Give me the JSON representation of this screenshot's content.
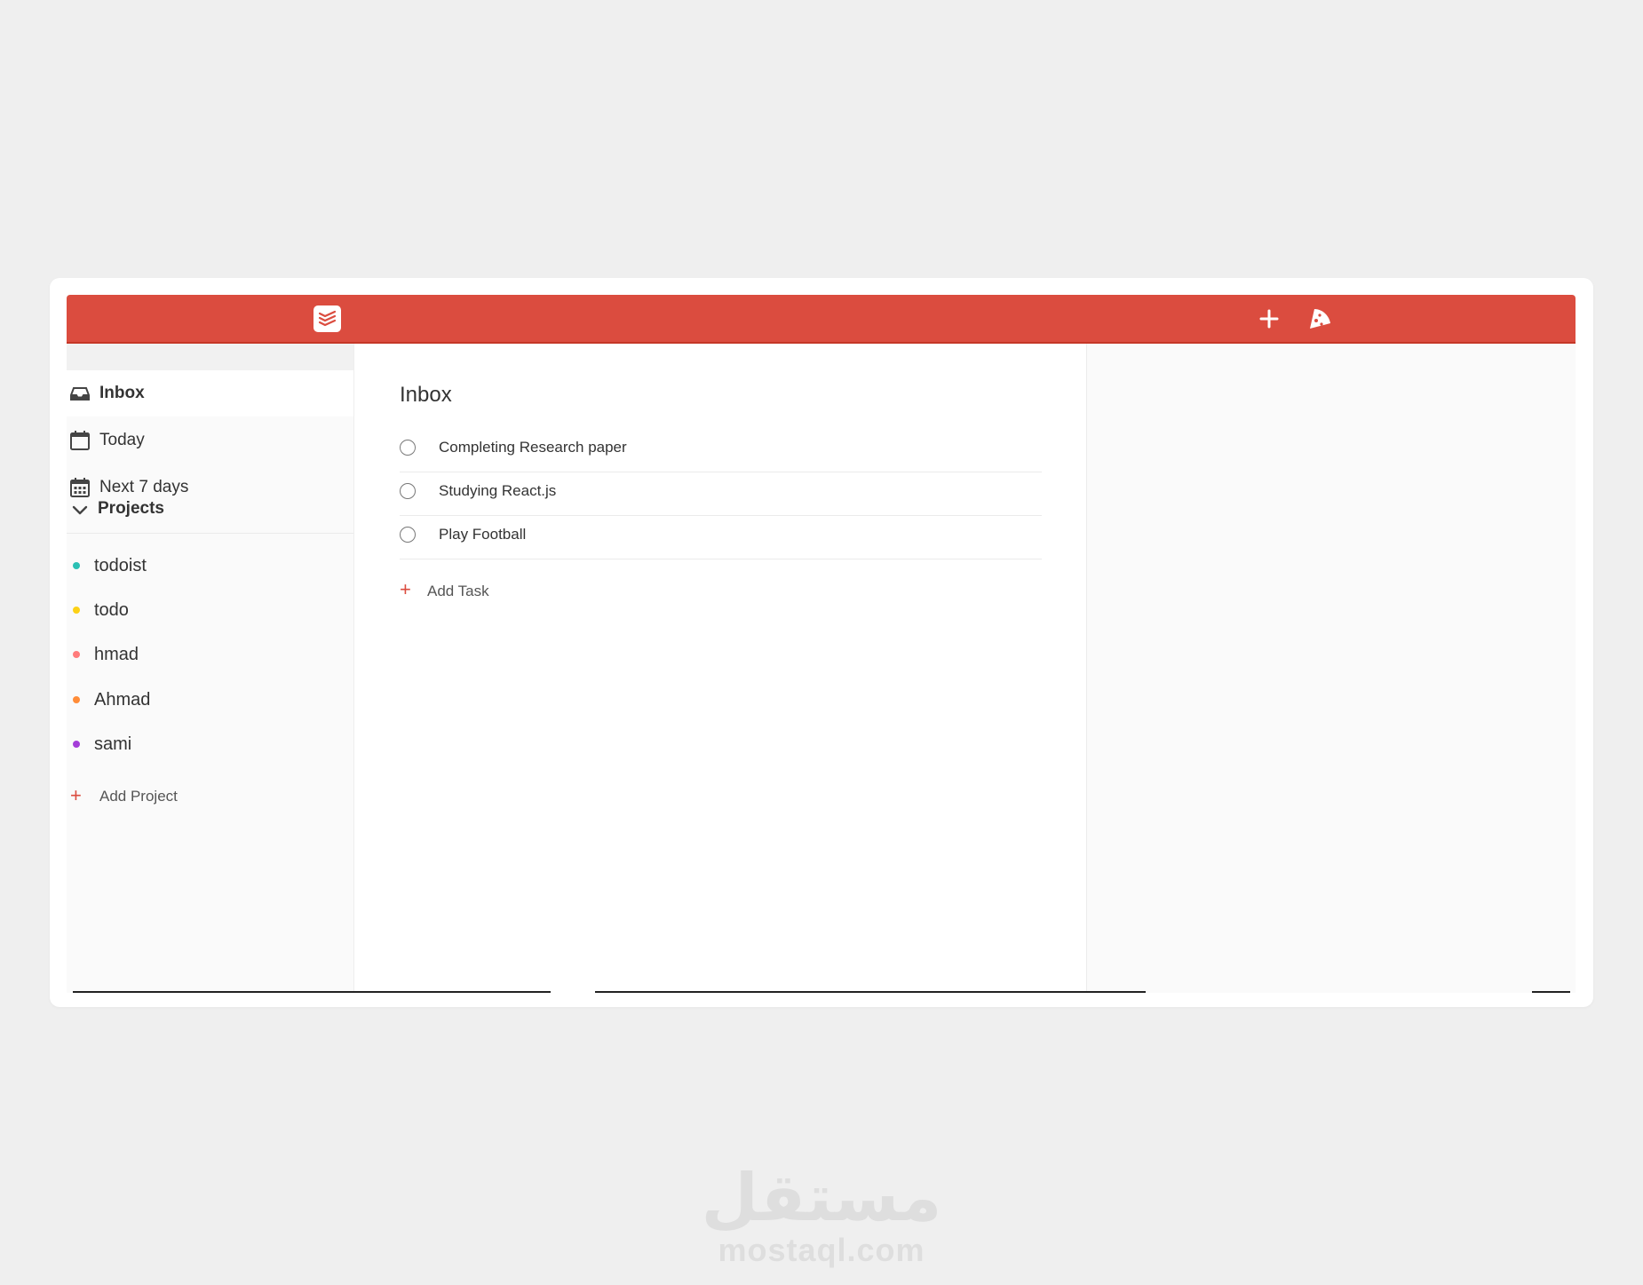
{
  "header": {
    "logo_icon": "todoist-logo-icon",
    "add_icon": "plus-icon",
    "productivity_icon": "pizza-slice-icon",
    "color": "#db4c3f"
  },
  "sidebar": {
    "nav": [
      {
        "label": "Inbox",
        "icon": "inbox-icon"
      },
      {
        "label": "Today",
        "icon": "calendar-icon"
      },
      {
        "label": "Next 7 days",
        "icon": "calendar-grid-icon"
      }
    ],
    "projects_label": "Projects",
    "projects": [
      {
        "label": "todoist",
        "color": "#2bc0b4"
      },
      {
        "label": "todo",
        "color": "#fcd116"
      },
      {
        "label": "hmad",
        "color": "#ff7b7b"
      },
      {
        "label": "Ahmad",
        "color": "#ff8c38"
      },
      {
        "label": "sami",
        "color": "#a43dd8"
      }
    ],
    "add_project": "Add Project",
    "add_symbol": "+"
  },
  "main": {
    "title": "Inbox",
    "tasks": [
      {
        "label": "Completing Research paper"
      },
      {
        "label": "Studying React.js"
      },
      {
        "label": "Play Football"
      }
    ],
    "add_task": "Add Task",
    "add_symbol": "+"
  },
  "watermark": {
    "arabic": "مستقل",
    "latin": "mostaql.com"
  }
}
